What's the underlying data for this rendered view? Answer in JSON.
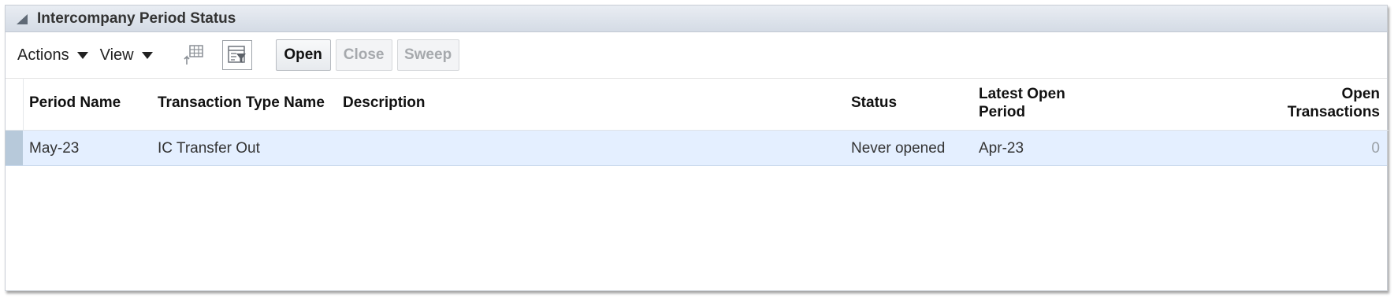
{
  "panel": {
    "title": "Intercompany Period Status"
  },
  "toolbar": {
    "actions_label": "Actions",
    "view_label": "View",
    "detach_icon": "table-detach-icon",
    "filter_icon": "query-by-example-icon",
    "open_label": "Open",
    "close_label": "Close",
    "sweep_label": "Sweep"
  },
  "table": {
    "columns": {
      "period_name": "Period Name",
      "transaction_type": "Transaction Type Name",
      "description": "Description",
      "status": "Status",
      "latest_open_1": "Latest Open",
      "latest_open_2": "Period",
      "open_tx_1": "Open",
      "open_tx_2": "Transactions"
    },
    "rows": [
      {
        "period_name": "May-23",
        "transaction_type": "IC Transfer Out",
        "description": "",
        "status": "Never opened",
        "latest_open_period": "Apr-23",
        "open_transactions": "0"
      }
    ]
  },
  "colors": {
    "header_bg": "#dde3ea",
    "selected_row": "#e4efff",
    "row_selector": "#b7c9da"
  }
}
